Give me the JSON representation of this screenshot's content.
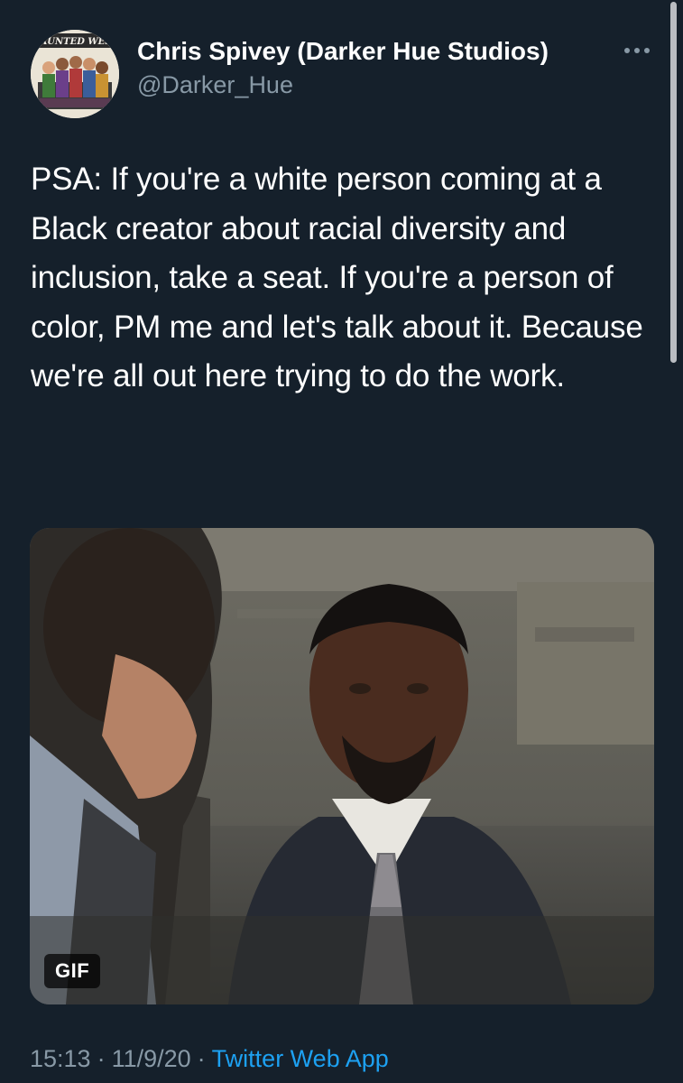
{
  "author": {
    "name": "Chris Spivey (Darker Hue Studios)",
    "handle": "@Darker_Hue",
    "avatar_banner": "HAUNTED WEST"
  },
  "more_icon": "more-horizontal-icon",
  "tweet": {
    "text": "PSA: If you're a white person coming at a Black creator about racial diversity and inclusion, take a seat. If you're a person of color, PM me and let's talk about it. Because we're all out here trying to do the work."
  },
  "media": {
    "badge": "GIF"
  },
  "meta": {
    "time": "15:13",
    "separator": "·",
    "date": "11/9/20",
    "source": "Twitter Web App"
  },
  "colors": {
    "background": "#15202b",
    "secondary_text": "#8899a6",
    "link": "#1da1f2"
  }
}
